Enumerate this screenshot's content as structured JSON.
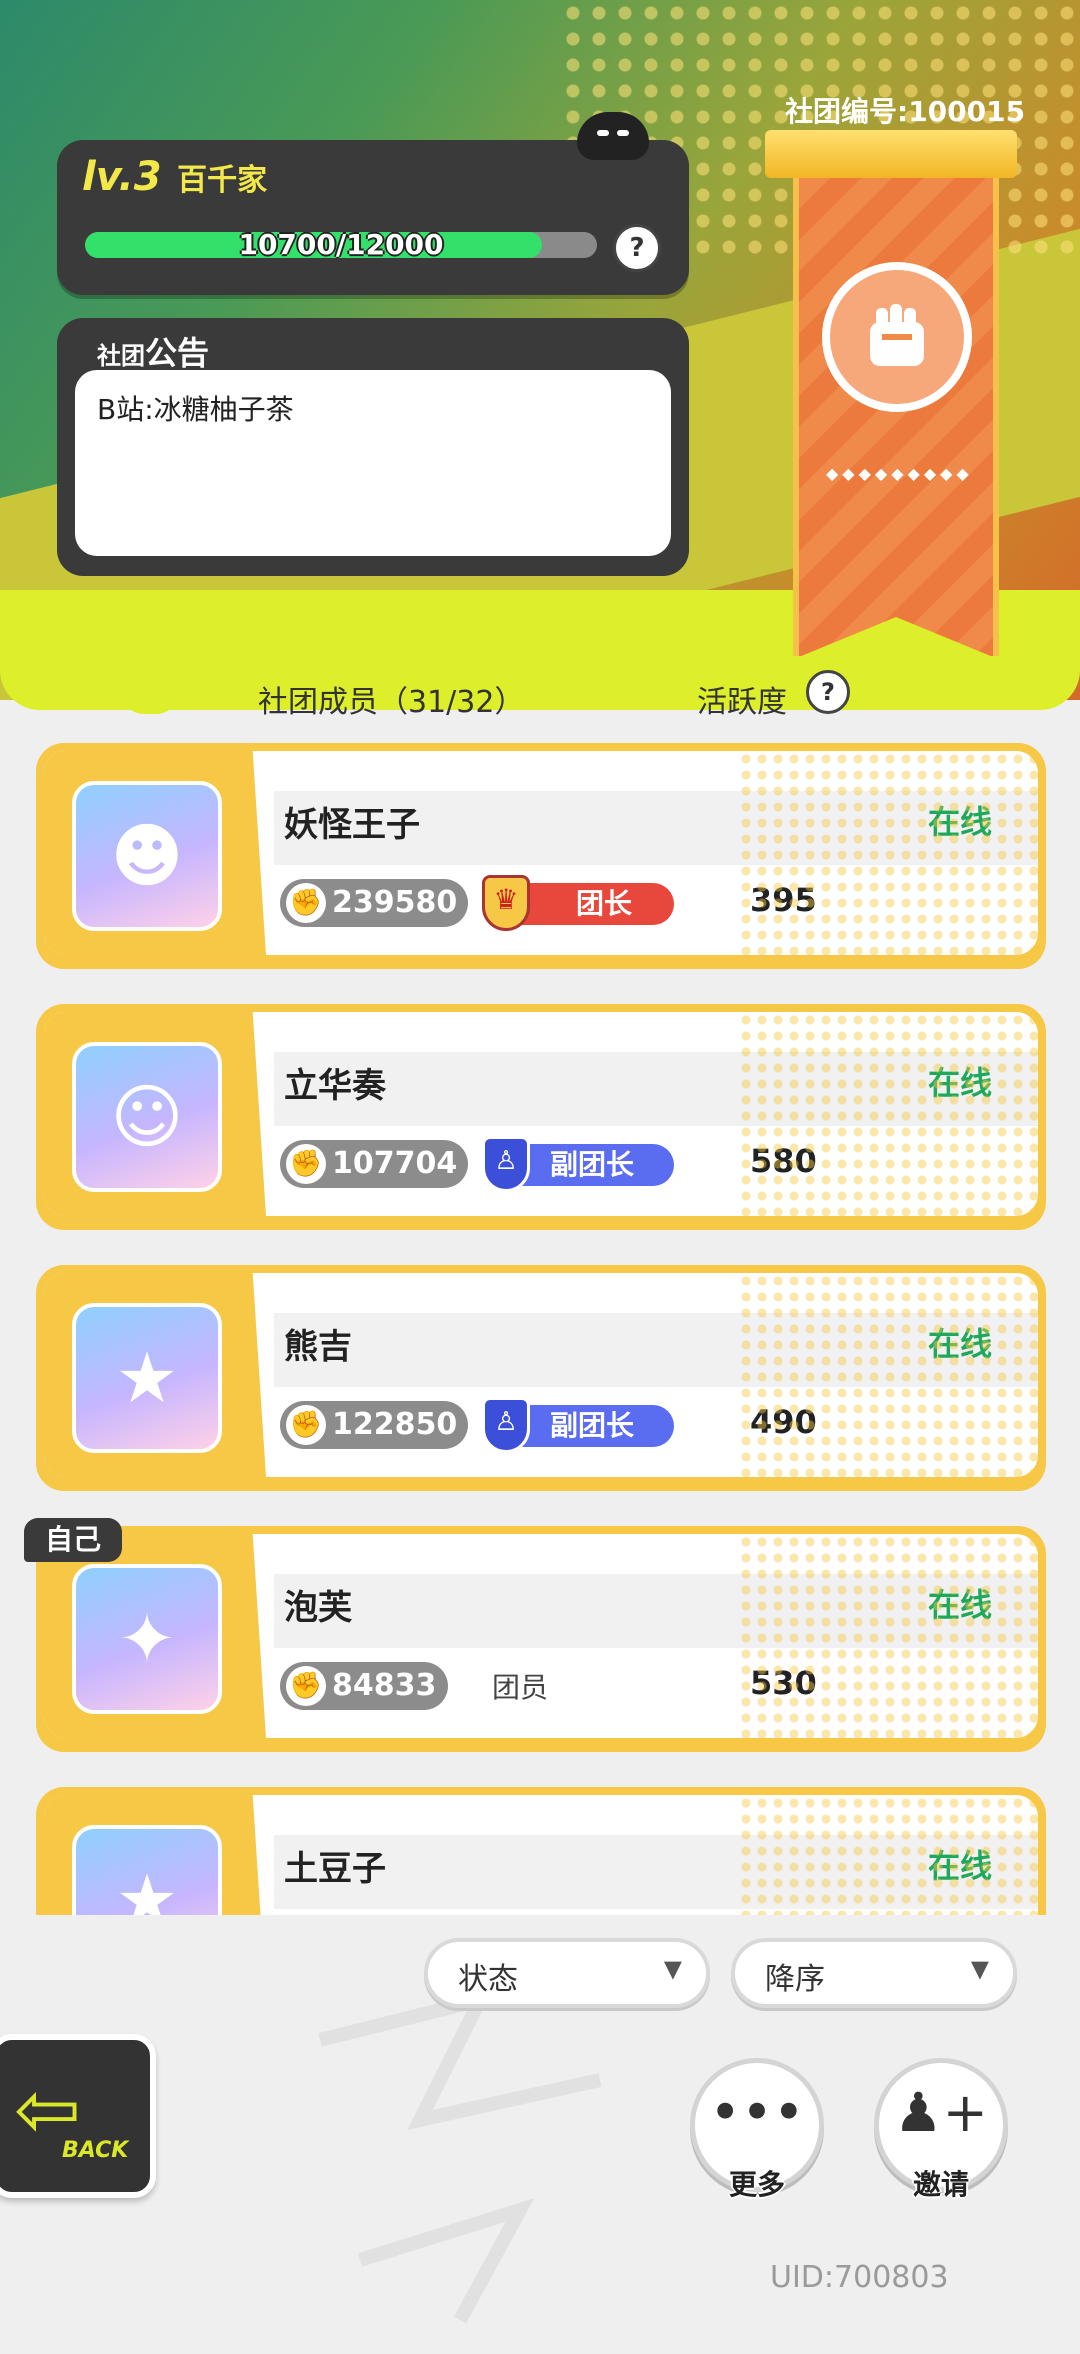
{
  "header": {
    "level": "lv.3",
    "level_name": "百千家",
    "xp_text": "10700/12000",
    "xp_fraction": 0.8917,
    "help": "?",
    "club_id": "社团编号:100015"
  },
  "notice": {
    "label_small": "社团",
    "label_big": "公告",
    "text": "B站:冰糖柚子茶"
  },
  "list_header": {
    "members": "社团成员（31/32）",
    "activity": "活跃度"
  },
  "members": [
    {
      "name": "妖怪王子",
      "status": "在线",
      "power": "239580",
      "role": "团长",
      "role_type": "leader",
      "activity": "395"
    },
    {
      "name": "立华奏",
      "status": "在线",
      "power": "107704",
      "role": "副团长",
      "role_type": "vice",
      "activity": "580"
    },
    {
      "name": "熊吉",
      "status": "在线",
      "power": "122850",
      "role": "副团长",
      "role_type": "vice",
      "activity": "490"
    },
    {
      "name": "泡芙",
      "status": "在线",
      "power": "84833",
      "role": "团员",
      "role_type": "member",
      "activity": "530",
      "self_tag": "自己"
    },
    {
      "name": "土豆子",
      "status": "在线"
    }
  ],
  "filters": {
    "status_label": "状态",
    "order_label": "降序"
  },
  "buttons": {
    "back": "BACK",
    "more": "更多",
    "invite": "邀请"
  },
  "uid": "UID:700803",
  "colors": {
    "online": "#1fa85a",
    "card_border": "#f6c845",
    "leader_tag": "#e8473c",
    "vice_tag": "#5a6df0",
    "xp_fill": "#33e06a"
  }
}
